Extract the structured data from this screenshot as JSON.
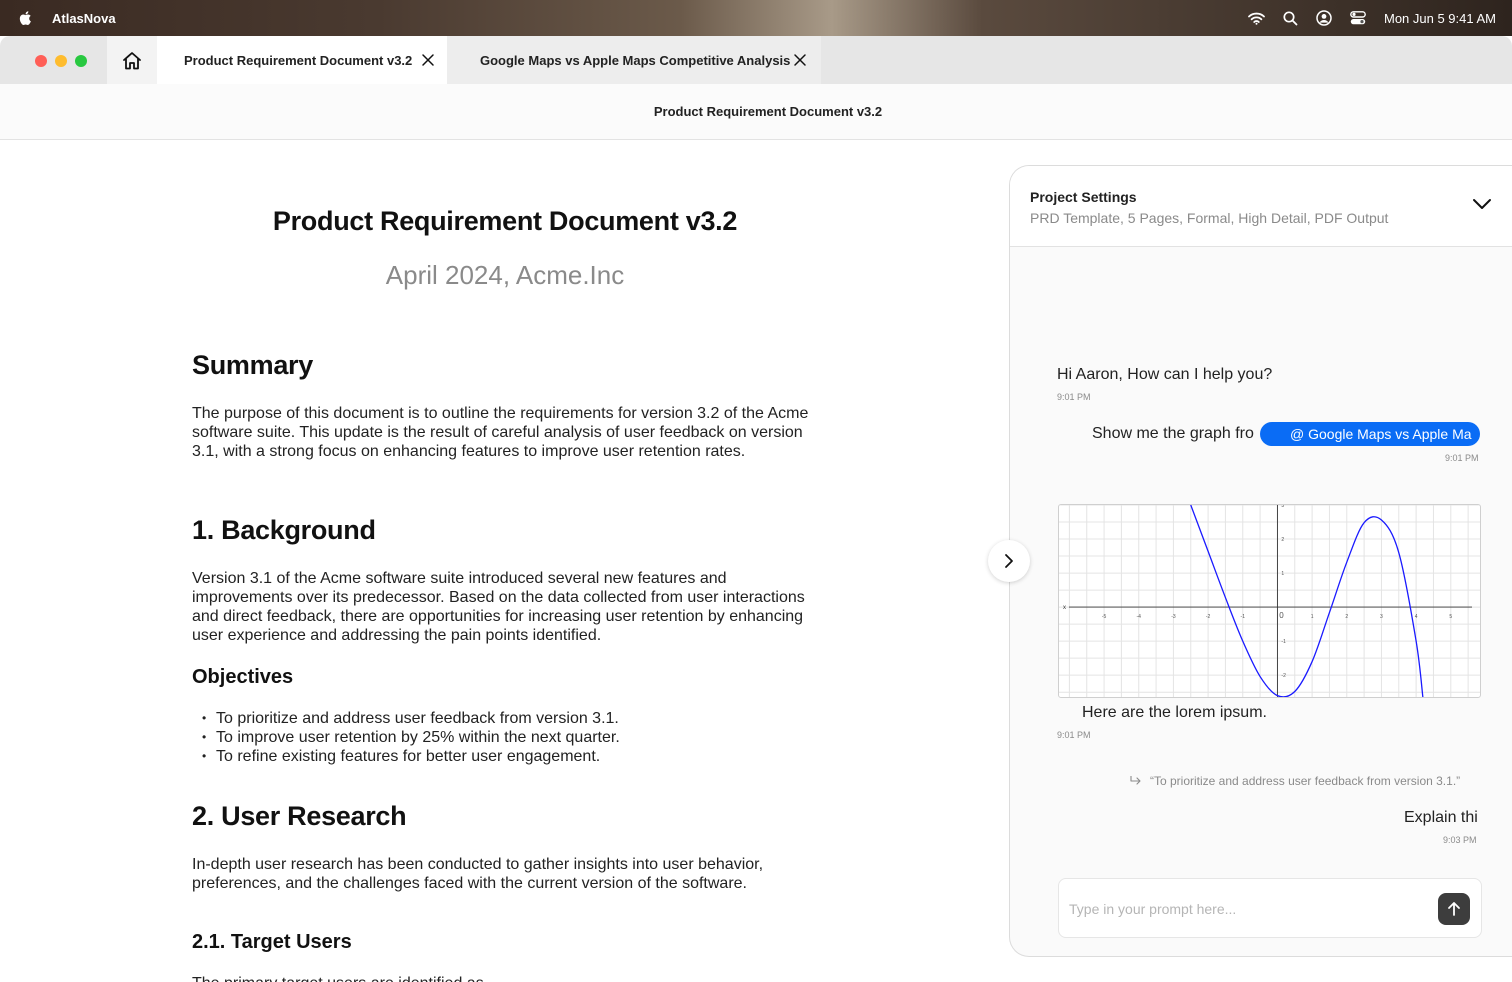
{
  "menubar": {
    "app_name": "AtlasNova",
    "clock": "Mon Jun 5  9:41 AM",
    "icons": [
      "apple-icon",
      "wifi-icon",
      "search-icon",
      "user-circle-icon",
      "control-center-icon"
    ]
  },
  "tabs": [
    {
      "label": "Product Requirement Document v3.2"
    },
    {
      "label": "Google Maps vs Apple Maps Competitive Analysis"
    }
  ],
  "window_title": "Product Requirement Document v3.2",
  "document": {
    "title": "Product Requirement Document v3.2",
    "subtitle": "April 2024, Acme.Inc",
    "summary_heading": "Summary",
    "summary_text": "The purpose of this document is to outline the requirements for version 3.2 of the Acme software suite. This update is the result of careful analysis of user feedback on version 3.1, with a strong focus on enhancing features to improve user retention rates.",
    "background_heading": "1. Background",
    "background_text": "Version 3.1 of the Acme software suite introduced several new features and improvements over its predecessor. Based on the data collected from user interactions and direct feedback, there are opportunities for increasing user retention by enhancing user experience and addressing the pain points identified.",
    "objectives_heading": "Objectives",
    "objectives": [
      "To prioritize and address user feedback from version 3.1.",
      "To improve user retention by 25% within the next quarter.",
      "To refine existing features for better user engagement."
    ],
    "research_heading": "2. User Research",
    "research_text": "In-depth user research has been conducted to gather insights into user behavior, preferences, and the challenges faced with the current version of the software.",
    "target_heading": "2.1. Target Users",
    "target_text": "The primary target users are identified as"
  },
  "panel": {
    "title": "Project Settings",
    "subtitle": "PRD Template, 5 Pages, Formal, High Detail, PDF Output",
    "messages": [
      {
        "text": "Hi Aaron, How can I help you?",
        "time": "9:01 PM"
      },
      {
        "text": "Show me the graph fro",
        "mention": "@ Google Maps vs Apple Ma",
        "time": "9:01 PM"
      },
      {
        "text": "Here are the lorem ipsum.",
        "time": "9:01 PM"
      },
      {
        "quote": "“To prioritize and address user feedback from version 3.1.”",
        "text": "Explain thi",
        "time": "9:03 PM"
      }
    ],
    "prompt_placeholder": "Type in your prompt here..."
  },
  "chart_data": {
    "type": "line",
    "title": "",
    "xlabel": "x",
    "ylabel": "",
    "x_ticks": [
      -5,
      -4,
      -3,
      -2,
      -1,
      0,
      1,
      2,
      3,
      4,
      5
    ],
    "y_ticks": [
      -2,
      -1,
      0,
      1,
      2,
      3
    ],
    "xlim": [
      -6.3,
      5.9
    ],
    "ylim": [
      -2.7,
      3.0
    ],
    "grid": true,
    "series": [
      {
        "color": "#1a1aff",
        "x": [
          -2.5,
          -2.0,
          -1.5,
          -1.0,
          -0.5,
          0.0,
          0.5,
          1.0,
          1.5,
          2.0,
          2.5,
          3.0,
          3.5,
          4.0,
          4.2
        ],
        "y": [
          3.0,
          1.64,
          0.28,
          -1.0,
          -2.04,
          -2.6,
          -2.48,
          -1.6,
          -0.16,
          1.32,
          2.48,
          2.56,
          1.6,
          -1.0,
          -2.7
        ]
      }
    ]
  }
}
